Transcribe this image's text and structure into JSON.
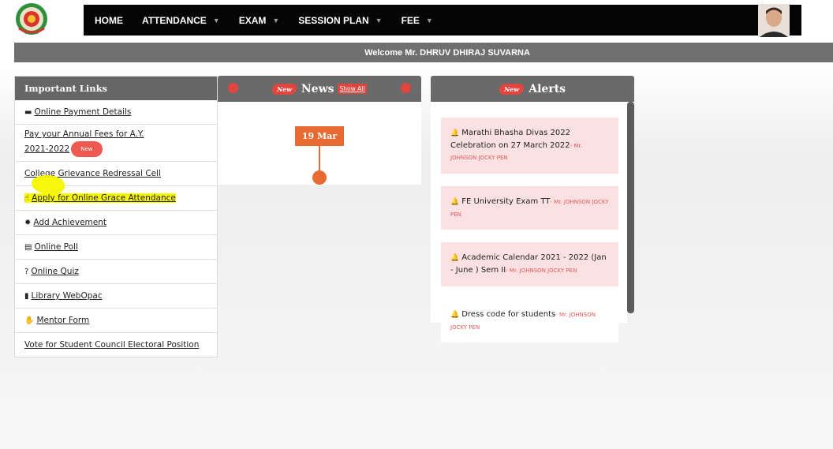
{
  "nav": {
    "items": [
      {
        "label": "HOME",
        "dropdown": false
      },
      {
        "label": "ATTENDANCE",
        "dropdown": true
      },
      {
        "label": "EXAM",
        "dropdown": true
      },
      {
        "label": "SESSION PLAN",
        "dropdown": true
      },
      {
        "label": "FEE",
        "dropdown": true
      }
    ],
    "caret": "▼"
  },
  "welcome": "Welcome  Mr. DHRUV DHIRAJ SUVARNA",
  "important_links": {
    "title": "Important Links",
    "items": [
      {
        "icon": "credit-card-icon",
        "glyph": "▬",
        "label": "Online Payment Details"
      },
      {
        "icon": "",
        "glyph": "",
        "label": "Pay your Annual Fees for A.Y. 2021-2022",
        "badge": "New"
      },
      {
        "icon": "",
        "glyph": "",
        "label": "College Grievance Redressal Cell"
      },
      {
        "icon": "hand-pointer-icon",
        "glyph": "☝",
        "label": "Apply for Online Grace Attendance",
        "highlighted": true
      },
      {
        "icon": "certificate-icon",
        "glyph": "✹",
        "label": "Add Achievement"
      },
      {
        "icon": "poll-icon",
        "glyph": "▤",
        "label": "Online Poll"
      },
      {
        "icon": "question-icon",
        "glyph": "?",
        "label": "Online Quiz"
      },
      {
        "icon": "book-icon",
        "glyph": "▮",
        "label": "Library WebOpac"
      },
      {
        "icon": "handshake-icon",
        "glyph": "✋",
        "label": "Mentor Form"
      },
      {
        "icon": "",
        "glyph": "",
        "label": "Vote for Student Council Electoral Position"
      }
    ]
  },
  "news": {
    "badge": "New",
    "title": "News",
    "show_all": "Show All",
    "date": "19 Mar"
  },
  "alerts": {
    "badge": "New",
    "title": "Alerts",
    "items": [
      {
        "text": "Marathi Bhasha Divas 2022 Celebration on 27 March 2022",
        "by": "- Mr. JOHNSON JOCKY PEN"
      },
      {
        "text": "FE University Exam TT",
        "by": "- Mr. JOHNSON JOCKY PEN"
      },
      {
        "text": "Academic Calendar 2021 - 2022 (Jan - June ) Sem II",
        "by": "- Mr. JOHNSON JOCKY PEN"
      },
      {
        "text": "Dress code for students",
        "by": "- Mr. JOHNSON JOCKY PEN"
      }
    ]
  },
  "colors": {
    "accent": "#e0453f",
    "nav_bg": "#050505",
    "panel_head": "#666666",
    "date_orange": "#e86a33",
    "alert_bg": "#fbe1e1",
    "highlight": "#f7f700"
  }
}
